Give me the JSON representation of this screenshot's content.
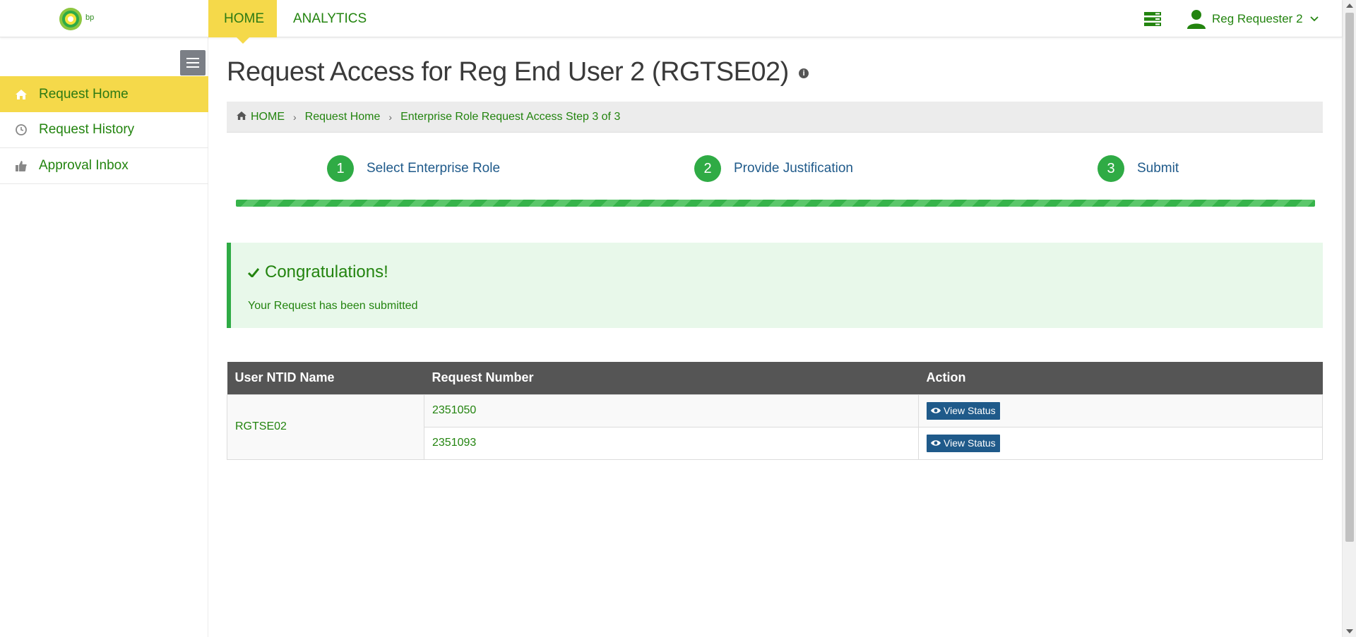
{
  "brand": {
    "logo_text": "bp",
    "primary_green": "#23840f",
    "accent_yellow": "#f5d94a",
    "step_green": "#2fab45",
    "button_blue": "#1f5a8a"
  },
  "topnav": {
    "tabs": [
      {
        "label": "HOME",
        "active": true
      },
      {
        "label": "ANALYTICS",
        "active": false
      }
    ]
  },
  "user": {
    "name": "Reg Requester 2"
  },
  "icons": {
    "apps": "stacked-list-icon",
    "user": "user-icon",
    "chevron": "chevron-down-icon"
  },
  "sidebar": {
    "items": [
      {
        "label": "Request Home",
        "icon": "home-icon",
        "active": true
      },
      {
        "label": "Request History",
        "icon": "clock-icon",
        "active": false
      },
      {
        "label": "Approval Inbox",
        "icon": "thumbs-up-icon",
        "active": false
      }
    ]
  },
  "page": {
    "title": "Request Access for Reg End User 2 (RGTSE02)",
    "info_glyph": "i"
  },
  "breadcrumb": {
    "items": [
      "HOME",
      "Request Home",
      "Enterprise Role Request Access Step 3 of 3"
    ]
  },
  "steps": [
    {
      "num": "1",
      "label": "Select Enterprise Role"
    },
    {
      "num": "2",
      "label": "Provide Justification"
    },
    {
      "num": "3",
      "label": "Submit"
    }
  ],
  "progress": {
    "percent": 100
  },
  "alert": {
    "title": "Congratulations!",
    "body": "Your Request has been submitted"
  },
  "table": {
    "headers": [
      "User NTID Name",
      "Request Number",
      "Action"
    ],
    "user_ntid": "RGTSE02",
    "rows": [
      {
        "request_number": "2351050",
        "action": "View Status"
      },
      {
        "request_number": "2351093",
        "action": "View Status"
      }
    ]
  }
}
